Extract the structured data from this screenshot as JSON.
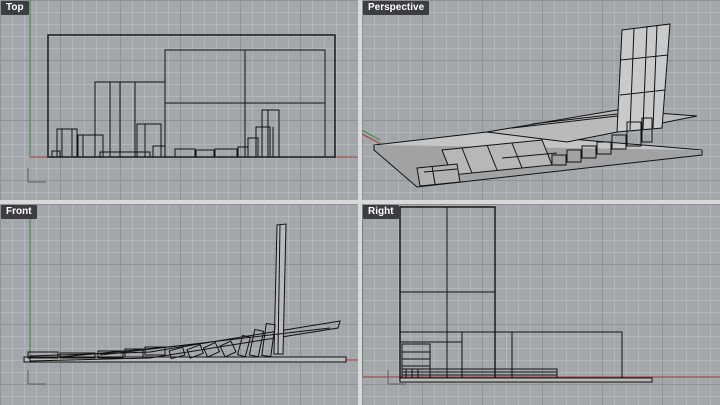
{
  "viewports": [
    {
      "id": "top",
      "label": "Top"
    },
    {
      "id": "perspective",
      "label": "Perspective"
    },
    {
      "id": "front",
      "label": "Front"
    },
    {
      "id": "right",
      "label": "Right"
    }
  ],
  "colors": {
    "viewport_bg": "#a3a6aa",
    "grid_major": "#8e9195",
    "grid_minor": "#b2b5b9",
    "x_axis": "#a33a3a",
    "y_axis": "#2f8a3a",
    "geometry": "#111111",
    "label_bg": "#3b3d40",
    "label_text": "#ffffff"
  }
}
